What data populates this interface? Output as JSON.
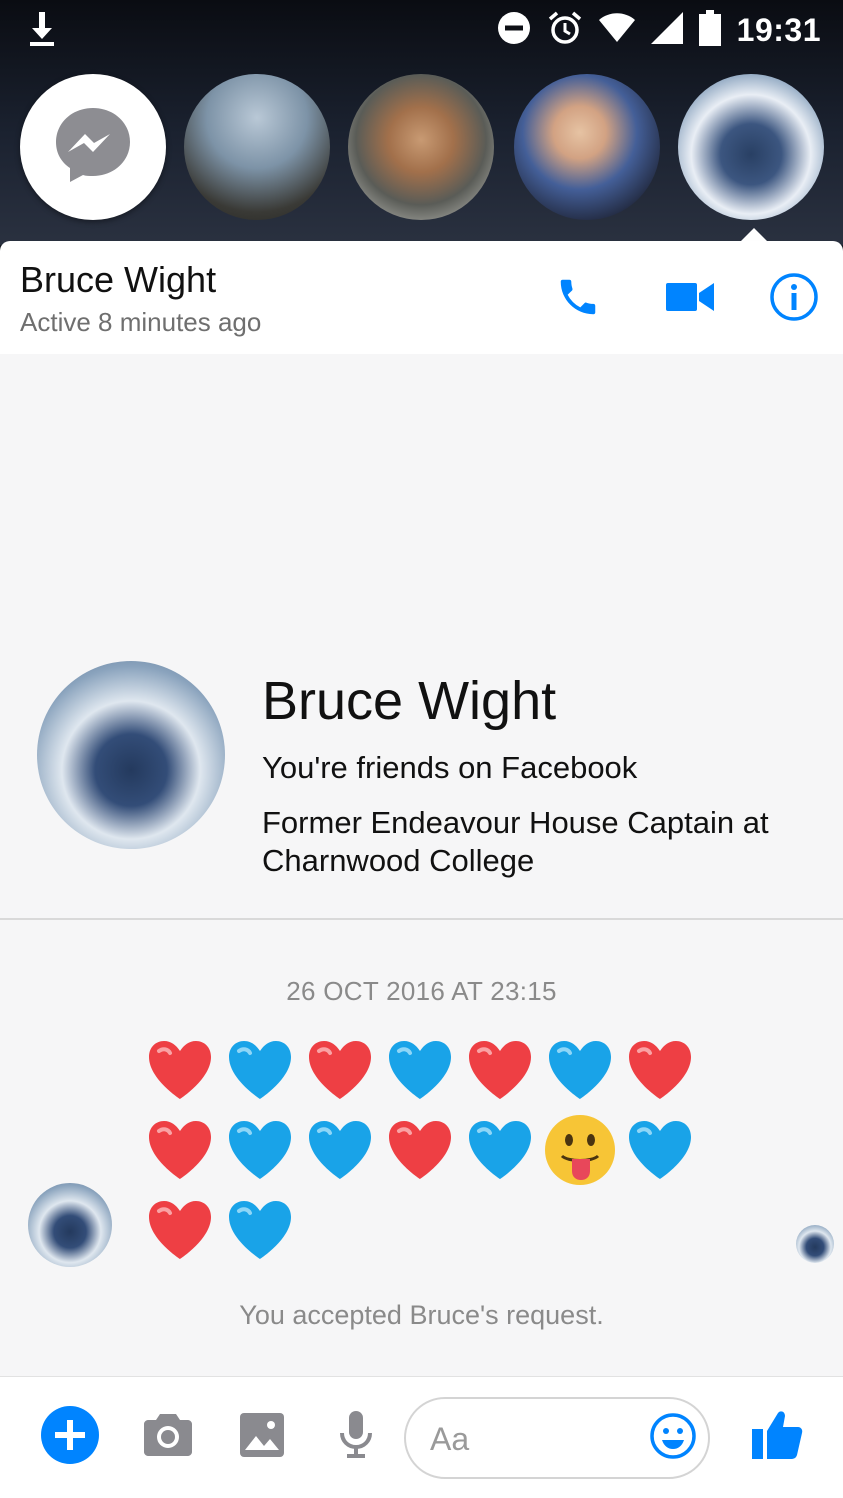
{
  "status_bar": {
    "time": "19:31",
    "icons": [
      "download-icon",
      "do-not-disturb-icon",
      "alarm-icon",
      "wifi-icon",
      "signal-icon",
      "battery-icon"
    ]
  },
  "chat_heads": [
    {
      "name": "messenger-icon"
    },
    {
      "name": "contact-avatar"
    },
    {
      "name": "contact-avatar"
    },
    {
      "name": "contact-avatar"
    },
    {
      "name": "contact-avatar"
    }
  ],
  "header": {
    "name": "Bruce Wight",
    "status": "Active 8 minutes ago",
    "accent": "#0084ff",
    "actions": [
      "phone-icon",
      "video-camera-icon",
      "info-icon"
    ]
  },
  "profile": {
    "name": "Bruce Wight",
    "relationship": "You're friends on Facebook",
    "work": "Former Endeavour House Captain at Charnwood College"
  },
  "messages": {
    "timestamp": "26 OCT 2016 AT 23:15",
    "emoji_rows": [
      [
        "red-heart",
        "blue-heart",
        "red-heart",
        "blue-heart",
        "red-heart",
        "blue-heart",
        "red-heart"
      ],
      [
        "red-heart",
        "blue-heart",
        "blue-heart",
        "red-heart",
        "blue-heart",
        "tongue-face",
        "blue-heart"
      ],
      [
        "red-heart",
        "blue-heart"
      ]
    ],
    "system_message": "You accepted Bruce's request."
  },
  "composer": {
    "placeholder": "Aa",
    "buttons": [
      "plus-icon",
      "camera-icon",
      "gallery-icon",
      "microphone-icon",
      "emoji-icon",
      "thumbs-up-icon"
    ],
    "accent": "#0084ff"
  }
}
